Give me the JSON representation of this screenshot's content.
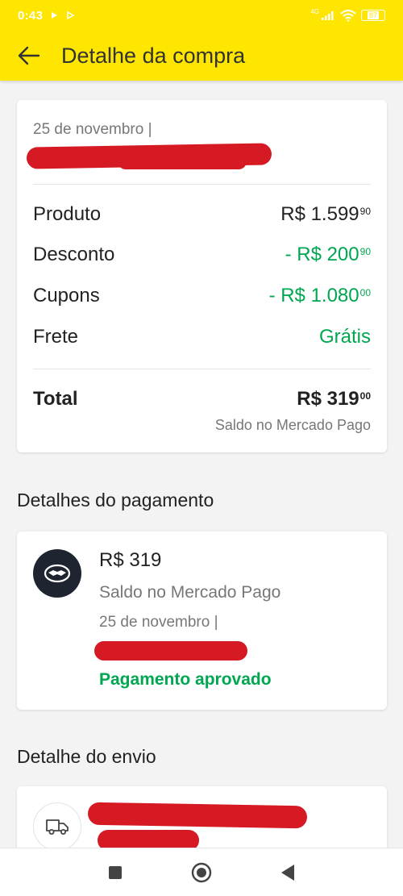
{
  "status_bar": {
    "time": "0:43",
    "battery": "87",
    "network": "4G"
  },
  "header": {
    "title": "Detalhe da compra",
    "back_icon": "arrow-left-icon"
  },
  "summary": {
    "date": "25 de novembro  |",
    "rows": [
      {
        "label": "Produto",
        "whole": "R$ 1.599",
        "cents": "90",
        "color": "#222222"
      },
      {
        "label": "Desconto",
        "whole": "- R$ 200",
        "cents": "90",
        "color": "#00a650"
      },
      {
        "label": "Cupons",
        "whole": "- R$ 1.080",
        "cents": "00",
        "color": "#00a650"
      },
      {
        "label": "Frete",
        "whole": "Grátis",
        "cents": "",
        "color": "#00a650"
      }
    ],
    "total": {
      "label": "Total",
      "whole": "R$ 319",
      "cents": "00"
    },
    "total_note": "Saldo no Mercado Pago"
  },
  "payment": {
    "section_title": "Detalhes do pagamento",
    "amount": "R$ 319",
    "method": "Saldo no Mercado Pago",
    "date": "25 de novembro  |",
    "status": "Pagamento aprovado",
    "icon": "mercado-pago-handshake-icon"
  },
  "shipping": {
    "section_title": "Detalhe do envio",
    "icon": "truck-icon"
  },
  "nav": {
    "icons": [
      "square-recents-icon",
      "circle-home-icon",
      "triangle-back-icon"
    ]
  },
  "colors": {
    "brand_yellow": "#ffe600",
    "success_green": "#00a650",
    "redaction_red": "#d51a24"
  }
}
